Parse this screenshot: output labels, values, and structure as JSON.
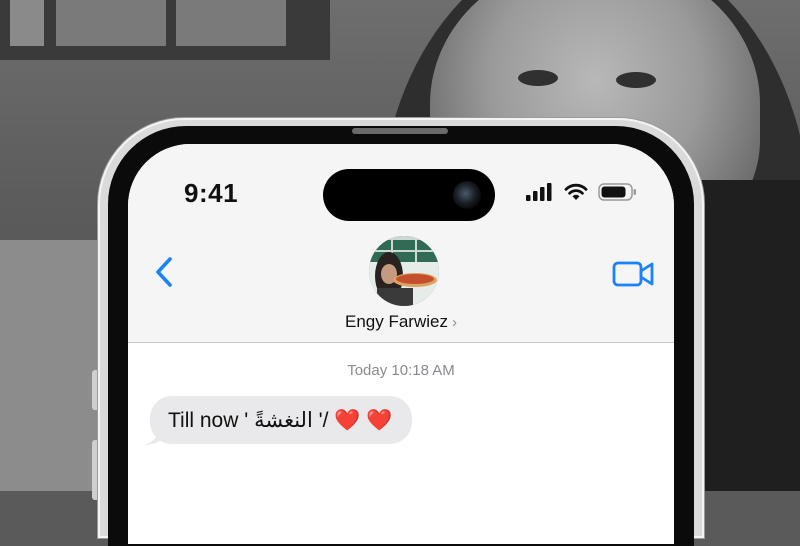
{
  "status_bar": {
    "time": "9:41"
  },
  "header": {
    "contact_name": "Engy Farwiez",
    "contact_chevron": "›"
  },
  "conversation": {
    "timestamp": "Today 10:18 AM",
    "messages": [
      {
        "text": "Till now ' النغشةً '/ ❤️ ❤️",
        "direction": "incoming"
      }
    ]
  },
  "icons": {
    "back": "chevron-left-icon",
    "video": "video-camera-icon",
    "signal": "cellular-signal-icon",
    "wifi": "wifi-icon",
    "battery": "battery-icon"
  },
  "colors": {
    "accent": "#1a82fb",
    "bubble": "#e9e9eb",
    "nav_bg": "#f5f5f6"
  }
}
